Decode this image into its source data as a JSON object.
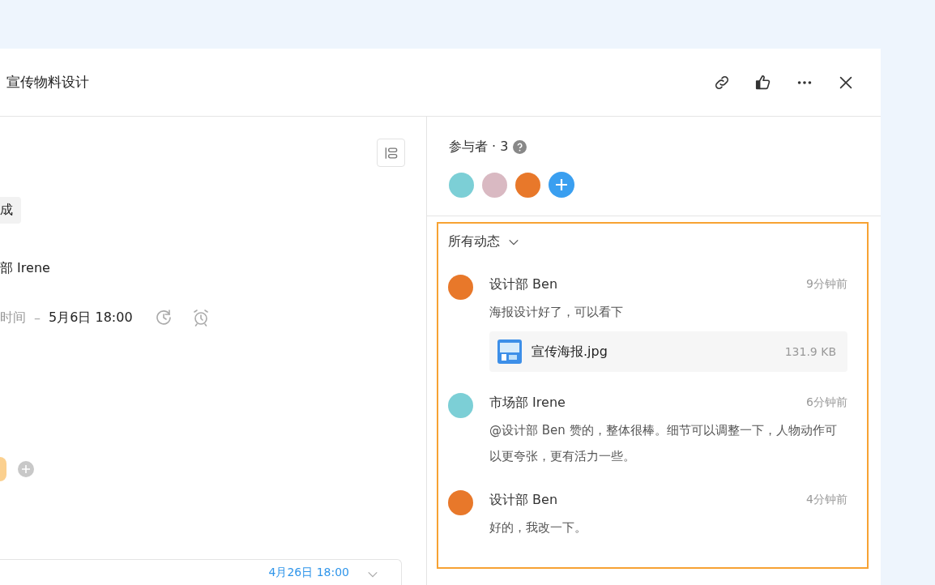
{
  "header": {
    "title": "宣传物料设计"
  },
  "details": {
    "status_tag": "成",
    "assignee": "部 Irene",
    "time_label": "时间",
    "time_separator": "–",
    "due": "5月6日 18:00",
    "bottom_date": "4月26日 18:00"
  },
  "participants": {
    "title": "参与者 · 3",
    "people": [
      {
        "color": "#7ccfd6"
      },
      {
        "color": "#d9b9c2"
      },
      {
        "color": "#e8782a"
      }
    ]
  },
  "activity": {
    "filter": "所有动态",
    "comments": [
      {
        "author": "设计部 Ben",
        "time": "9分钟前",
        "text": "海报设计好了，可以看下",
        "color": "#e8782a",
        "attachment": {
          "name": "宣传海报.jpg",
          "size": "131.9 KB"
        }
      },
      {
        "author": "市场部 Irene",
        "time": "6分钟前",
        "text": "@设计部 Ben 赞的，整体很棒。细节可以调整一下，人物动作可以更夸张，更有活力一些。",
        "color": "#7ccfd6"
      },
      {
        "author": "设计部 Ben",
        "time": "4分钟前",
        "text": "好的，我改一下。",
        "color": "#e8782a"
      }
    ]
  }
}
